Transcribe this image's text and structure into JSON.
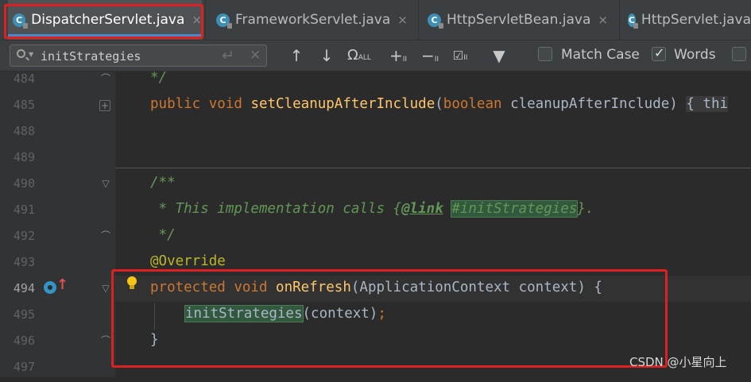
{
  "tabs": [
    {
      "label": "DispatcherServlet.java",
      "icon": "java-class-icon",
      "active": true
    },
    {
      "label": "FrameworkServlet.java",
      "icon": "java-class-icon",
      "active": false
    },
    {
      "label": "HttpServletBean.java",
      "icon": "java-class-icon",
      "active": false
    },
    {
      "label": "HttpServlet.java",
      "icon": "java-class-icon",
      "active": false
    }
  ],
  "tab_close_glyph": "×",
  "find": {
    "query": "initStrategies",
    "match_case_label": "Match Case",
    "match_case_checked": false,
    "words_label": "Words",
    "words_checked": true
  },
  "editor": {
    "lines": [
      {
        "num": "484"
      },
      {
        "num": "485"
      },
      {
        "num": "488"
      },
      {
        "num": "489"
      },
      {
        "num": "490"
      },
      {
        "num": "491"
      },
      {
        "num": "492"
      },
      {
        "num": "493"
      },
      {
        "num": "494"
      },
      {
        "num": "495"
      },
      {
        "num": "496"
      },
      {
        "num": "497"
      }
    ],
    "code": {
      "l484": "*/",
      "l485_kw": "public void ",
      "l485_fn": "setCleanupAfterInclude",
      "l485_p1": "(",
      "l485_kw2": "boolean ",
      "l485_rest": "cleanupAfterInclude) ",
      "l485_brace": "{ thi",
      "l490": "/**",
      "l491_a": " * This implementation calls {",
      "l491_tag": "@link",
      "l491_b": " ",
      "l491_match": "#initStrategies",
      "l491_c": "}.",
      "l492": " */",
      "l493": "@Override",
      "l494_kw": "protected void ",
      "l494_fn": "onRefresh",
      "l494_rest": "(ApplicationContext context) {",
      "l495_match": "initStrategies",
      "l495_rest": "(context)",
      "l495_semi": ";",
      "l496": "}"
    }
  },
  "watermark": "CSDN @小星向上",
  "colors": {
    "background": "#2b2b2b",
    "keyword": "#cc7832",
    "method": "#ffc66d",
    "doc_comment": "#629755",
    "annotation": "#bbb529",
    "highlight_box": "#e02020",
    "search_match": "#32593d"
  }
}
